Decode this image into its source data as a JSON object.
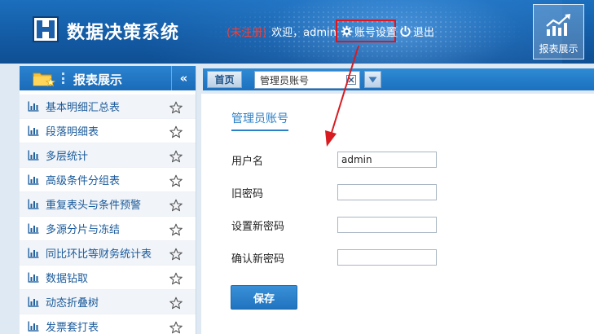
{
  "header": {
    "app_title": "数据决策系统",
    "unregistered": "(未注册)",
    "welcome": "欢迎，admin",
    "account_settings": "账号设置",
    "logout": "退出",
    "report_tile_label": "报表展示"
  },
  "sidebar": {
    "title": "报表展示",
    "collapse_glyph": "«",
    "items": [
      {
        "label": "基本明细汇总表"
      },
      {
        "label": "段落明细表"
      },
      {
        "label": "多层统计"
      },
      {
        "label": "高级条件分组表"
      },
      {
        "label": "重复表头与条件预警"
      },
      {
        "label": "多源分片与冻结"
      },
      {
        "label": "同比环比等财务统计表"
      },
      {
        "label": "数据钻取"
      },
      {
        "label": "动态折叠树"
      },
      {
        "label": "发票套打表"
      }
    ]
  },
  "tabs": {
    "home": "首页",
    "active": "管理员账号"
  },
  "form": {
    "section_title": "管理员账号",
    "username_label": "用户名",
    "username_value": "admin",
    "old_password_label": "旧密码",
    "new_password_label": "设置新密码",
    "confirm_password_label": "确认新密码",
    "save_label": "保存"
  },
  "colors": {
    "header_blue": "#135aa3",
    "accent_blue": "#2b7fc6",
    "annotation_red": "#e0141b"
  },
  "icons": {
    "logo": "logo-icon",
    "gear": "gear-icon",
    "power": "power-icon",
    "chart_tile": "chart-trend-icon",
    "folder": "folder-star-icon",
    "bar": "bar-chart-icon",
    "star": "star-icon",
    "close": "close-icon",
    "dropdown": "triangle-down-icon"
  }
}
